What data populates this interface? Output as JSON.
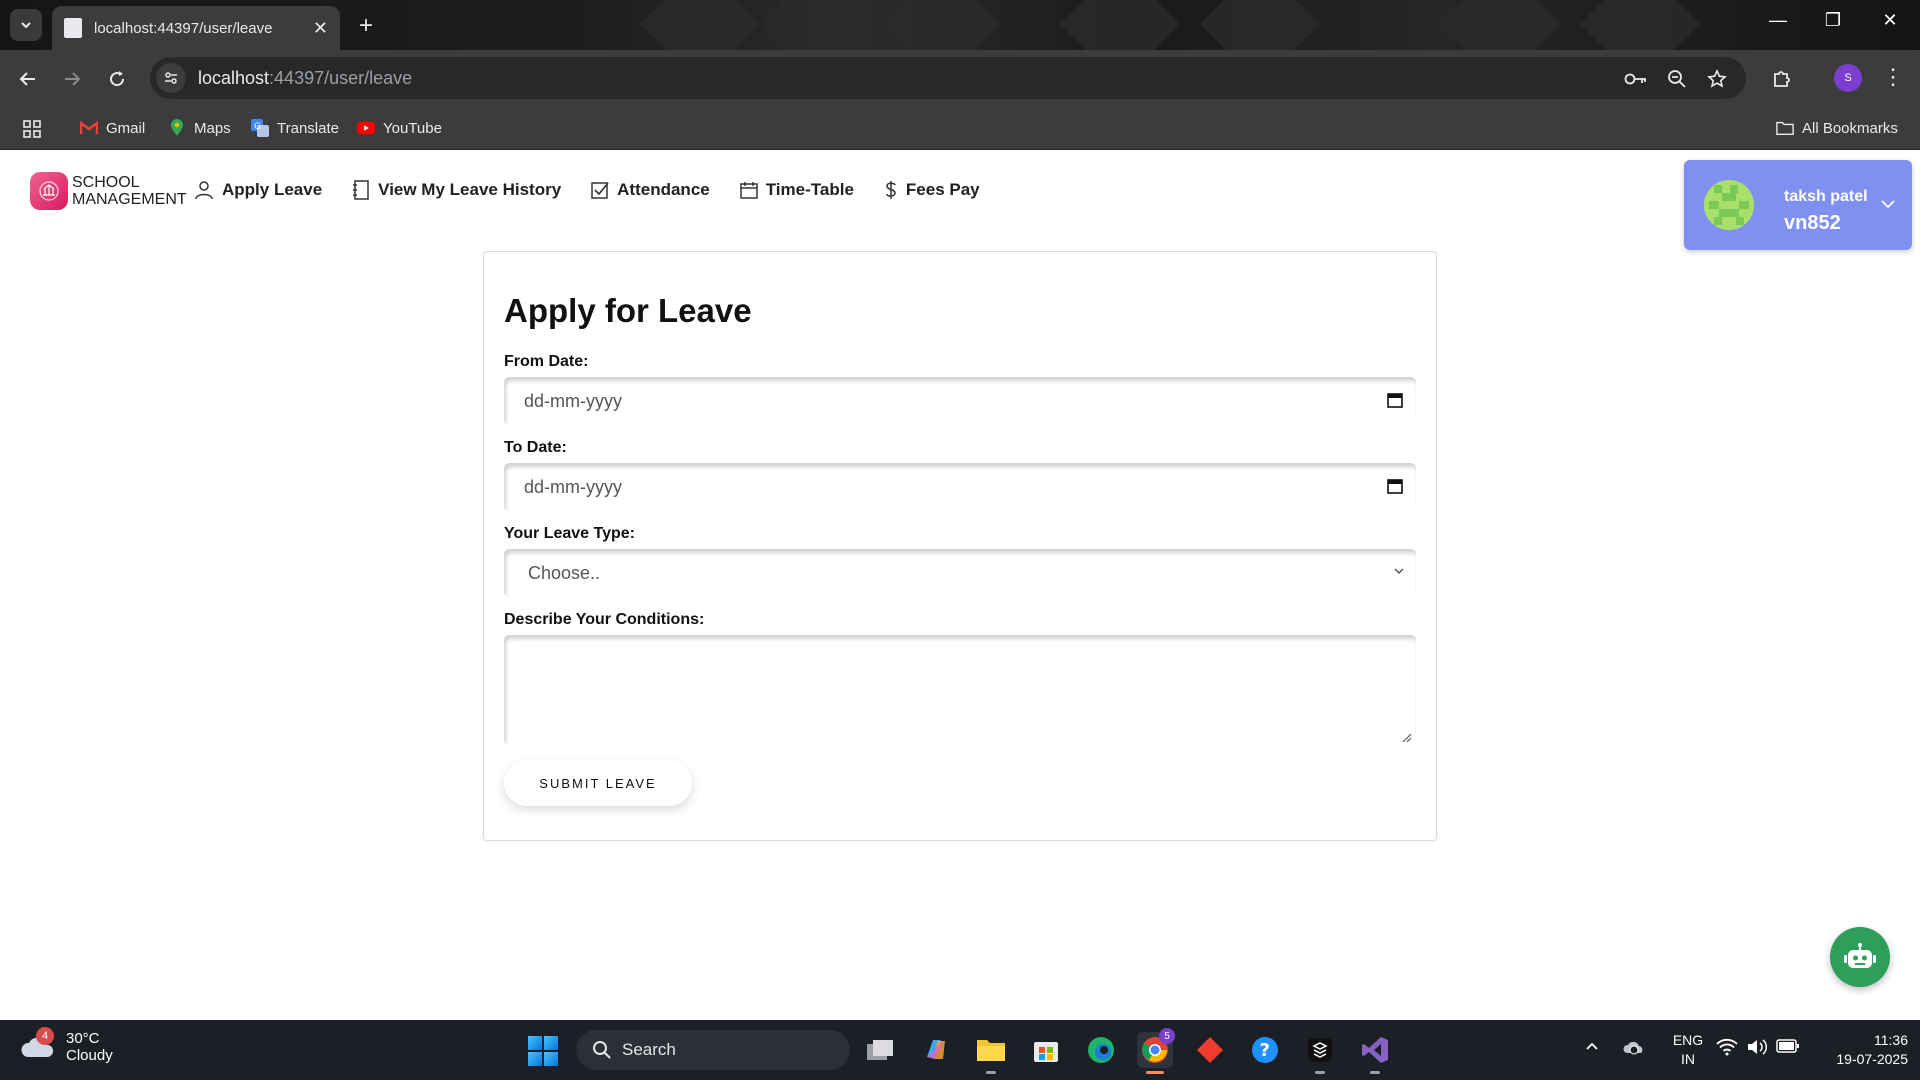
{
  "browser": {
    "tab_title": "localhost:44397/user/leave",
    "url_host": "localhost",
    "url_rest": ":44397/user/leave",
    "profile_initial": "S",
    "bookmarks": [
      "Gmail",
      "Maps",
      "Translate",
      "YouTube"
    ],
    "all_bookmarks": "All Bookmarks"
  },
  "app": {
    "brand_line1": "SCHOOL",
    "brand_line2": "MANAGEMENT",
    "nav": [
      "Apply Leave",
      "View My Leave History",
      "Attendance",
      "Time-Table",
      "Fees Pay"
    ],
    "user": {
      "name": "taksh patel",
      "id": "vn852"
    }
  },
  "form": {
    "title": "Apply for Leave",
    "from_label": "From Date:",
    "from_placeholder": "dd-mm-yyyy",
    "to_label": "To Date:",
    "to_placeholder": "dd-mm-yyyy",
    "type_label": "Your Leave Type:",
    "type_selected": "Choose..",
    "conditions_label": "Describe Your Conditions:",
    "submit": "SUBMIT LEAVE"
  },
  "taskbar": {
    "weather_temp": "30°C",
    "weather_cond": "Cloudy",
    "weather_badge": "4",
    "search": "Search",
    "chrome_badge": "5",
    "lang_1": "ENG",
    "lang_2": "IN",
    "time": "11:36",
    "date": "19-07-2025"
  },
  "colors": {
    "user_card": "#8090f0",
    "brand": "#e04c8a",
    "chatbot": "#2e9e5b"
  }
}
